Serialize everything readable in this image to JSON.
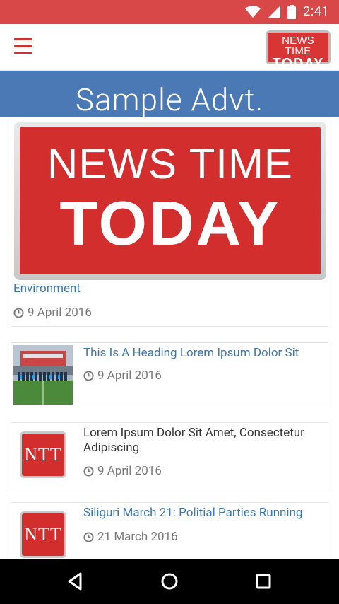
{
  "status_bar": {
    "time": "2:41"
  },
  "app_bar": {
    "logo_line1": "NEWS TIME",
    "logo_line2": "TODAY"
  },
  "advert": {
    "text": "Sample Advt."
  },
  "feature": {
    "image_line1": "NEWS TIME",
    "image_line2": "TODAY",
    "title": "Environment",
    "date": "9 April 2016"
  },
  "articles": [
    {
      "title": "This Is A Heading Lorem Ipsum Dolor Sit",
      "date": "9 April 2016"
    },
    {
      "title": "Lorem Ipsum Dolor Sit Amet, Consectetur Adipiscing",
      "date": "9 April 2016",
      "thumb_text": "NTT"
    },
    {
      "title": "Siliguri March 21: Politial Parties Running",
      "date": "21 March 2016",
      "thumb_text": "NTT"
    }
  ],
  "colors": {
    "status_bar": "#d94848",
    "advert_bg": "#4b79b5",
    "link": "#3a78b3",
    "brand_red": "#d22e2e"
  },
  "icons": [
    "wifi-icon",
    "signal-icon",
    "battery-icon",
    "menu-icon",
    "clock-icon",
    "back-icon",
    "home-icon",
    "recents-icon"
  ]
}
